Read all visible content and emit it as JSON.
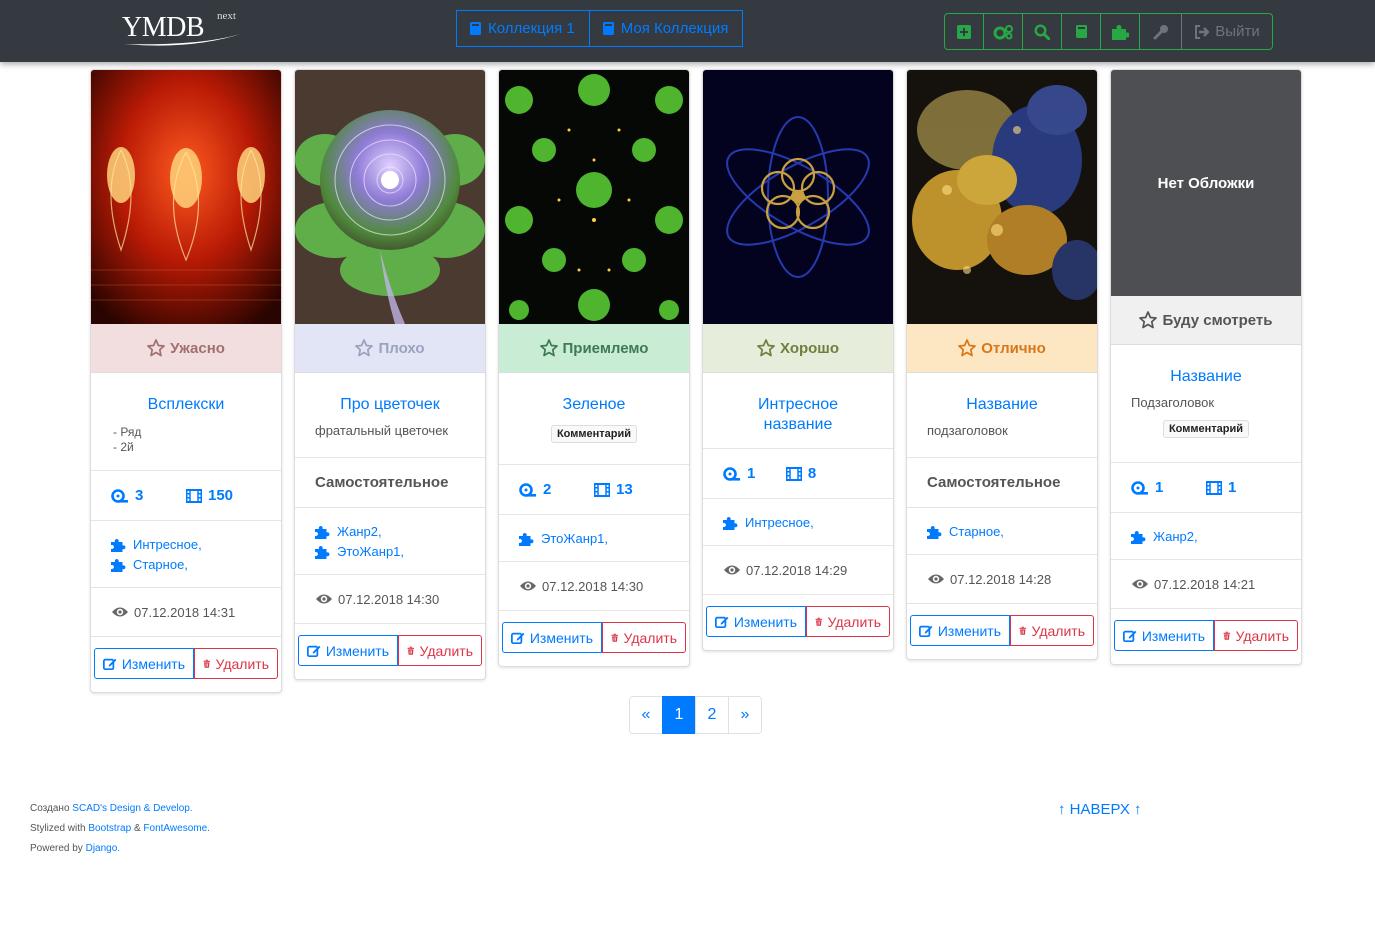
{
  "navbar": {
    "logo_text": "YMDB",
    "logo_suffix": "next",
    "collections": [
      "Коллекция 1",
      "Моя Коллекция"
    ],
    "tools": [
      "plus-square-icon",
      "cogs-icon",
      "search-icon",
      "book-icon",
      "puzzle-icon",
      "key-icon"
    ],
    "logout_label": "Выйти"
  },
  "cards": [
    {
      "rating": "Ужасно",
      "title": "Всплекски",
      "lines": [
        "- Ряд",
        "- 2й"
      ],
      "seasons": "3",
      "episodes": "150",
      "genres": [
        "Интресное,",
        "Старное,"
      ],
      "date": "07.12.2018 14:31"
    },
    {
      "rating": "Плохо",
      "title": "Про цветочек",
      "subtitle": "фратальный цветочек",
      "type": "Самостоятельное",
      "genres": [
        "Жанр2,",
        "ЭтоЖанр1,"
      ],
      "date": "07.12.2018 14:30"
    },
    {
      "rating": "Приемлемо",
      "title": "Зеленое",
      "comment": "Комментарий",
      "seasons": "2",
      "episodes": "13",
      "genres": [
        "ЭтоЖанр1,"
      ],
      "date": "07.12.2018 14:30"
    },
    {
      "rating": "Хорошо",
      "title": "Интресное название",
      "seasons": "1",
      "episodes": "8",
      "genres": [
        "Интресное,"
      ],
      "date": "07.12.2018 14:29"
    },
    {
      "rating": "Отлично",
      "title": "Название",
      "subtitle": "подзаголовок",
      "type": "Самостоятельное",
      "genres": [
        "Старное,"
      ],
      "date": "07.12.2018 14:28"
    },
    {
      "rating": "Буду смотреть",
      "no_cover": "Нет Обложки",
      "title": "Название",
      "subtitle": "Подзаголовок",
      "comment": "Комментарий",
      "seasons": "1",
      "episodes": "1",
      "genres": [
        "Жанр2,"
      ],
      "date": "07.12.2018 14:21"
    }
  ],
  "actions": {
    "edit": "Изменить",
    "delete": "Удалить"
  },
  "pagination": {
    "prev": "«",
    "pages": [
      "1",
      "2"
    ],
    "next": "»",
    "active": "1"
  },
  "footer": {
    "line1_prefix": "Создано ",
    "line1_link": "SCAD's Design & Develop.",
    "line2_prefix": "Stylized with ",
    "line2_link1": "Bootstrap",
    "line2_mid": " & ",
    "line2_link2": "FontAwesome.",
    "line3_prefix": "Powered by ",
    "line3_link": "Django."
  },
  "to_top": "↑ НАВЕРХ ↑",
  "colors": {
    "primary": "#007bff",
    "success": "#28a745",
    "danger": "#dc3545",
    "navbar": "#343a40"
  }
}
